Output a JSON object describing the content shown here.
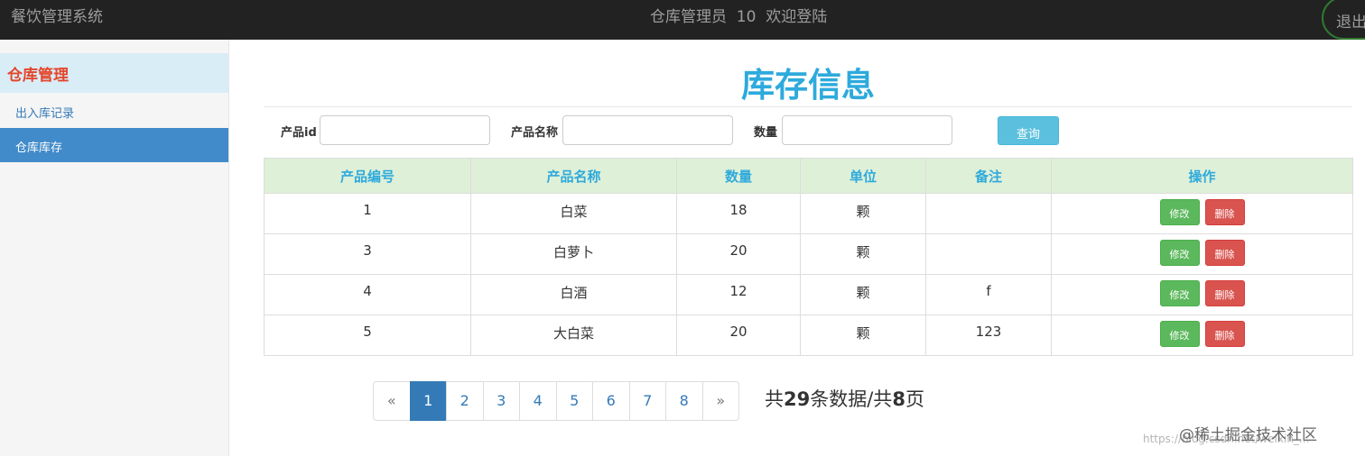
{
  "header": {
    "brand": "餐饮管理系统",
    "welcome": "仓库管理员  10  欢迎登陆",
    "logout_label": "退出"
  },
  "sidebar": {
    "title": "仓库管理",
    "items": [
      {
        "label": "出入库记录",
        "active": false
      },
      {
        "label": "仓库库存",
        "active": true
      }
    ]
  },
  "main": {
    "title": "库存信息",
    "filters": {
      "id_label": "产品id",
      "id_value": "",
      "name_label": "产品名称",
      "name_value": "",
      "qty_label": "数量",
      "qty_value": "",
      "query_label": "查询"
    },
    "table": {
      "headers": [
        "产品编号",
        "产品名称",
        "数量",
        "单位",
        "备注",
        "操作"
      ],
      "edit_label": "修改",
      "delete_label": "删除",
      "rows": [
        {
          "id": "1",
          "name": "白菜",
          "qty": "18",
          "unit": "颗",
          "note": ""
        },
        {
          "id": "3",
          "name": "白萝卜",
          "qty": "20",
          "unit": "颗",
          "note": ""
        },
        {
          "id": "4",
          "name": "白酒",
          "qty": "12",
          "unit": "颗",
          "note": "f"
        },
        {
          "id": "5",
          "name": "大白菜",
          "qty": "20",
          "unit": "颗",
          "note": "123"
        }
      ]
    },
    "pagination": {
      "prev": "«",
      "pages": [
        "1",
        "2",
        "3",
        "4",
        "5",
        "6",
        "7",
        "8"
      ],
      "current": "1",
      "next": "»",
      "summary_prefix": "共",
      "total_records": "29",
      "summary_mid": "条数据/共",
      "total_pages": "8",
      "summary_suffix": "页"
    }
  },
  "watermark": {
    "site": "@稀土掘金技术社区",
    "url": "https://blog.csdn.net/weixin_..."
  },
  "colors": {
    "navbar": "#222222",
    "title_accent": "#2eaadc",
    "sidebar_active": "#428bca",
    "edit_green": "#5cb85c",
    "delete_red": "#d9534f"
  }
}
